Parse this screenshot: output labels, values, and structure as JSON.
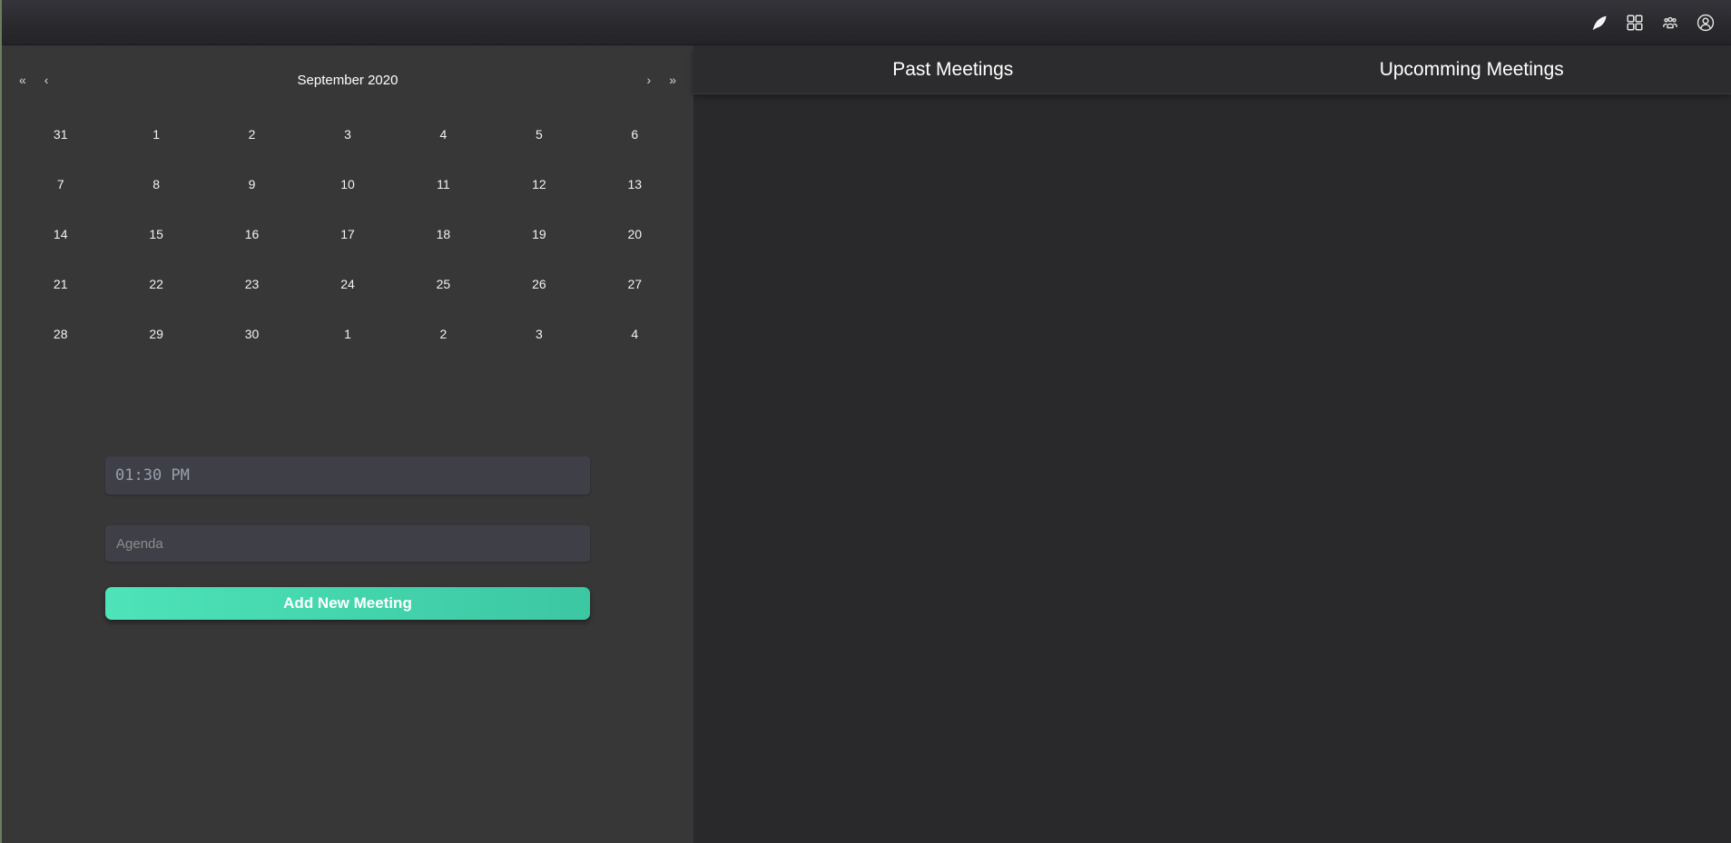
{
  "navbar": {
    "icons": [
      "feather-icon",
      "apps-grid-icon",
      "team-icon",
      "profile-icon"
    ]
  },
  "calendar": {
    "month_label": "September 2020",
    "nav": {
      "prev_year": "«",
      "prev_month": "‹",
      "next_month": "›",
      "next_year": "»"
    },
    "cells": [
      "31",
      "1",
      "2",
      "3",
      "4",
      "5",
      "6",
      "7",
      "8",
      "9",
      "10",
      "11",
      "12",
      "13",
      "14",
      "15",
      "16",
      "17",
      "18",
      "19",
      "20",
      "21",
      "22",
      "23",
      "24",
      "25",
      "26",
      "27",
      "28",
      "29",
      "30",
      "1",
      "2",
      "3",
      "4"
    ]
  },
  "meeting_form": {
    "time_value": "01:30 PM",
    "agenda_placeholder": "Agenda",
    "submit_label": "Add New Meeting"
  },
  "meetings": {
    "past_title": "Past Meetings",
    "upcoming_title": "Upcomming Meetings"
  },
  "colors": {
    "accent_gradient_start": "#4ee3b8",
    "accent_gradient_end": "#3bc7a2",
    "left_panel_bg": "#373737",
    "right_panel_bg": "#29292b",
    "header_bg": "#2c2c2e",
    "input_bg": "#3f3f47"
  }
}
